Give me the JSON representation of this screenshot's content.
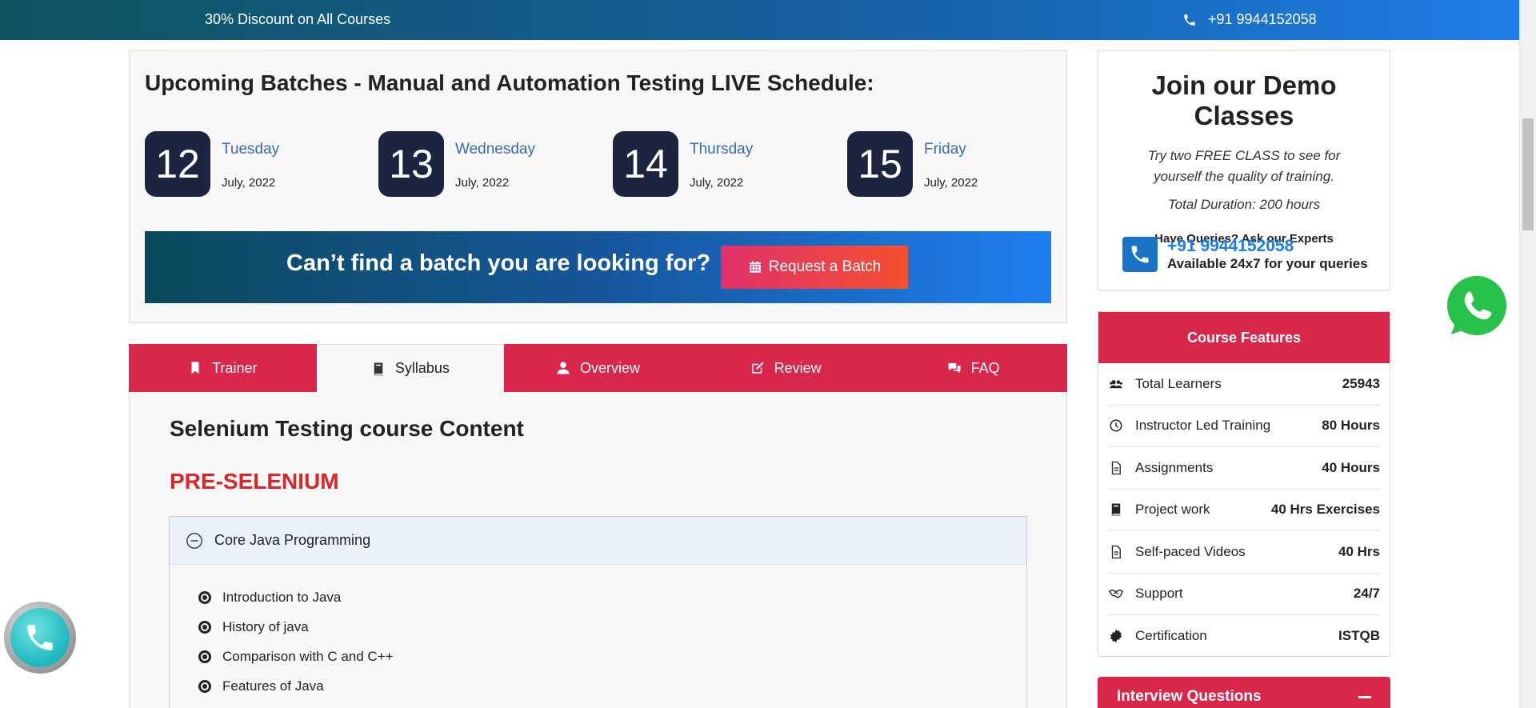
{
  "topbar": {
    "promo": "30% Discount on All Courses",
    "phone": "+91 9944152058"
  },
  "batches": {
    "title": "Upcoming Batches - Manual and Automation Testing LIVE Schedule:",
    "dates": [
      {
        "day_num": "12",
        "weekday": "Tuesday",
        "month": "July, 2022"
      },
      {
        "day_num": "13",
        "weekday": "Wednesday",
        "month": "July, 2022"
      },
      {
        "day_num": "14",
        "weekday": "Thursday",
        "month": "July, 2022"
      },
      {
        "day_num": "15",
        "weekday": "Friday",
        "month": "July, 2022"
      }
    ],
    "cta_text": "Can’t find a batch you are looking for?",
    "cta_button": "Request a Batch"
  },
  "tabs": [
    {
      "label": "Trainer",
      "icon": "bookmark-icon",
      "active": false
    },
    {
      "label": "Syllabus",
      "icon": "book-icon",
      "active": true
    },
    {
      "label": "Overview",
      "icon": "user-icon",
      "active": false
    },
    {
      "label": "Review",
      "icon": "edit-icon",
      "active": false
    },
    {
      "label": "FAQ",
      "icon": "comments-icon",
      "active": false
    }
  ],
  "content": {
    "title": "Selenium Testing course Content",
    "section": "PRE-SELENIUM",
    "accordion": {
      "title": "Core Java Programming",
      "items": [
        "Introduction to Java",
        "History of java",
        "Comparison with C and C++",
        "Features of Java"
      ]
    }
  },
  "demo": {
    "title": "Join our Demo Classes",
    "tryfree": "Try two FREE CLASS to see for yourself the quality of training.",
    "duration": "Total Duration: 200 hours",
    "queries": "Have Queries? Ask our Experts",
    "phone": "+91 9944152058",
    "availability": "Available 24x7 for your queries"
  },
  "features": {
    "title": "Course Features",
    "rows": [
      {
        "label": "Total Learners",
        "value": "25943",
        "icon": "users-icon"
      },
      {
        "label": "Instructor Led Training",
        "value": "80 Hours",
        "icon": "clock-icon"
      },
      {
        "label": "Assignments",
        "value": "40 Hours",
        "icon": "file-icon"
      },
      {
        "label": "Project work",
        "value": "40 Hrs Exercises",
        "icon": "book-icon"
      },
      {
        "label": "Self-paced Videos",
        "value": "40 Hrs",
        "icon": "file-icon"
      },
      {
        "label": "Support",
        "value": "24/7",
        "icon": "handshake-icon"
      },
      {
        "label": "Certification",
        "value": "ISTQB",
        "icon": "certificate-icon"
      }
    ]
  },
  "interview": {
    "title": "Interview Questions"
  },
  "colors": {
    "accent_red": "#d9264b",
    "navy": "#1c2440",
    "link_blue": "#3a6ab0",
    "section_red": "#d9262b"
  }
}
